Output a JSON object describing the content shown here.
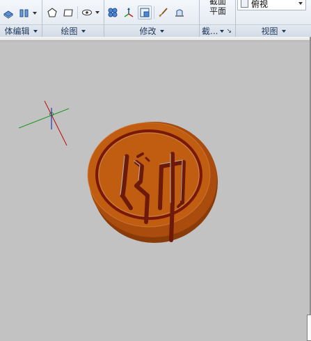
{
  "ribbon": {
    "panels": [
      {
        "id": "solid-edit",
        "label": "体编辑"
      },
      {
        "id": "draw",
        "label": "绘图"
      },
      {
        "id": "modify",
        "label": "修改"
      },
      {
        "id": "section",
        "label": "截..."
      },
      {
        "id": "view",
        "label": "视图"
      }
    ],
    "section": {
      "line1": "截面",
      "line2": "平面"
    },
    "view": {
      "selected": "俯视"
    }
  },
  "colors": {
    "background": "#c2c2c2",
    "piece_body": "#c05d10",
    "piece_ring": "#7a1808",
    "x_axis": "#c41414",
    "y_axis": "#1c9a1c",
    "z_axis": "#1428c8"
  },
  "icons": [
    "solid-edit-icon",
    "split-icon",
    "polygon-icon",
    "rectangle-icon",
    "visibility-icon",
    "array-icon",
    "move-gizmo-icon",
    "scale-icon",
    "brush-icon",
    "extrude-icon"
  ],
  "scene": {
    "piece_character": "帅"
  }
}
